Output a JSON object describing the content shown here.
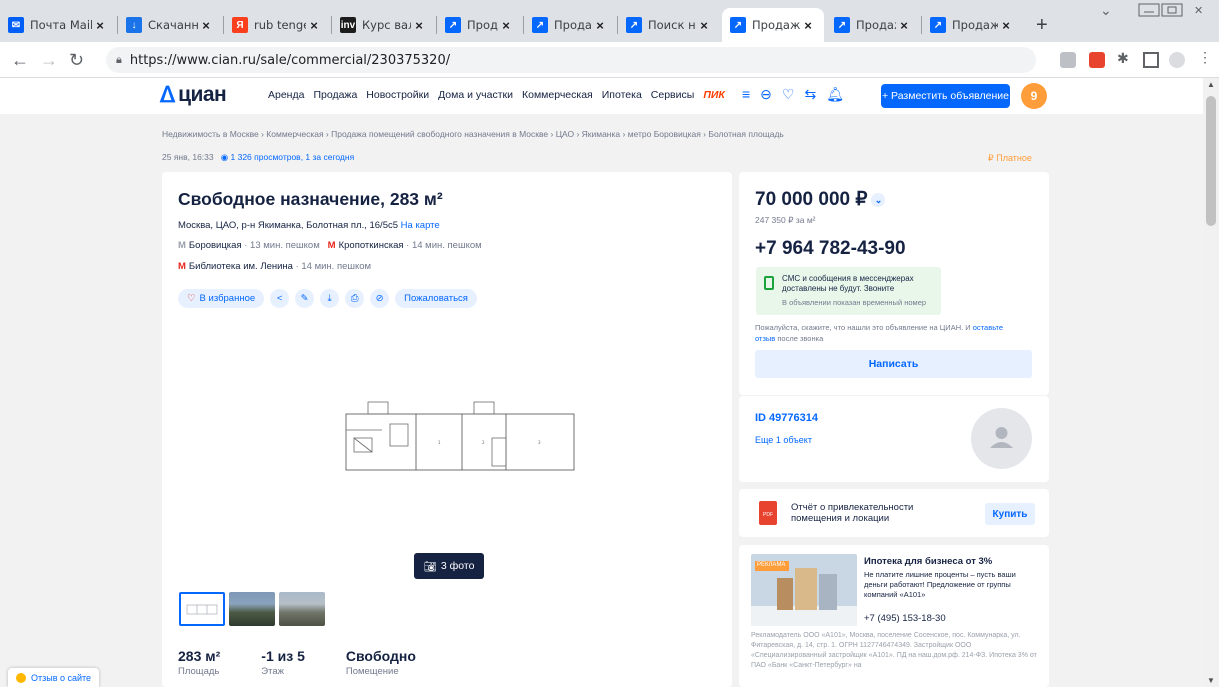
{
  "browser": {
    "tabs": [
      {
        "title": "Почта Mail.ru",
        "favicon_color": "#005ff9",
        "favicon_glyph": "✉"
      },
      {
        "title": "Скачанные файлы",
        "favicon_color": "#1a73e8",
        "favicon_glyph": "↓"
      },
      {
        "title": "rub tenge",
        "favicon_color": "#fc3f1d",
        "favicon_glyph": "Я"
      },
      {
        "title": "Курс валют",
        "favicon_color": "#1c1c1c",
        "favicon_glyph": "inv"
      },
      {
        "title": "Продаю",
        "favicon_color": "#0468ff",
        "favicon_glyph": "↗"
      },
      {
        "title": "Продаю",
        "favicon_color": "#0468ff",
        "favicon_glyph": "↗"
      },
      {
        "title": "Поиск на",
        "favicon_color": "#0468ff",
        "favicon_glyph": "↗"
      },
      {
        "title": "Продажа",
        "favicon_color": "#0468ff",
        "favicon_glyph": "↗",
        "active": true
      },
      {
        "title": "Продажа",
        "favicon_color": "#0468ff",
        "favicon_glyph": "↗"
      },
      {
        "title": "Продажа",
        "favicon_color": "#0468ff",
        "favicon_glyph": "↗"
      }
    ],
    "url": "https://www.cian.ru/sale/commercial/230375320/"
  },
  "header": {
    "logo": "циан",
    "nav": [
      "Аренда",
      "Продажа",
      "Новостройки",
      "Дома и участки",
      "Коммерческая",
      "Ипотека",
      "Сервисы"
    ],
    "nav_pik": "ПИК",
    "post_button": "+ Разместить объявление",
    "avatar_label": "9"
  },
  "breadcrumbs": "Недвижимость в Москве  ›  Коммерческая  ›  Продажа помещений свободного назначения в Москве  ›  ЦАО  ›  Якиманка  ›  метро Боровицкая  ›  Болотная площадь",
  "meta": {
    "date": "25 янв, 16:33",
    "views": "1 326 просмотров, 1 за сегодня",
    "paid": "₽ Платное"
  },
  "listing": {
    "title": "Свободное назначение, 283 м²",
    "address": "Москва, ЦАО, р-н Якиманка, Болотная пл., 16/5с5",
    "on_map": "На карте",
    "metro": [
      {
        "name": "Боровицкая",
        "walk": " · 13 мин. пешком",
        "color": "#9aa0ab"
      },
      {
        "name": "Кропоткинская",
        "walk": " · 14 мин. пешком",
        "color": "#e8281e"
      },
      {
        "name": "Библиотека им. Ленина",
        "walk": " · 14 мин. пешком",
        "color": "#e8281e"
      }
    ],
    "favorite_label": "В избранное",
    "complain_label": "Пожаловаться",
    "photos_button": "3 фото",
    "facts": [
      {
        "value": "283 м²",
        "label": "Площадь"
      },
      {
        "value": "-1 из 5",
        "label": "Этаж"
      },
      {
        "value": "Свободно",
        "label": "Помещение"
      }
    ]
  },
  "sidebar": {
    "price": "70 000 000 ₽",
    "price_per_m": "247 350 ₽ за м²",
    "phone": "+7 964 782-43-90",
    "sms_notice": "СМС и сообщения в мессенджерах доставлены не будут. Звоните",
    "temp_number": "В объявлении показан временный номер",
    "feedback_text": "Пожалуйста, скажите, что нашли это объявление на ЦИАН. И",
    "feedback_link": "оставьте отзыв",
    "feedback_tail": "после звонка",
    "write_button": "Написать",
    "agent_id": "ID 49776314",
    "more_objects": "Еще 1 объект",
    "report_text": "Отчёт о привлекательности помещения и локации",
    "buy_button": "Купить",
    "pdf_label": "PDF"
  },
  "ad": {
    "badge": "РЕКЛАМА",
    "title": "Ипотека для бизнеса от 3%",
    "text": "Не платите лишние проценты – пусть ваши деньги работают! Предложение от группы компаний «А101»",
    "phone": "+7 (495) 153-18-30",
    "legal": "Рекламодатель ООО «А101», Москва, поселение Сосенское, пос. Коммунарка, ул. Фитаревская, д. 14, стр. 1. ОГРН 1127746474349. Застройщик ООО «Специализированный застройщик «А101». ПД на наш.дом.рф. 214-ФЗ. Ипотека 3% от ПАО «Банк «Санкт-Петербург» на"
  },
  "site_feedback": "Отзыв о сайте"
}
